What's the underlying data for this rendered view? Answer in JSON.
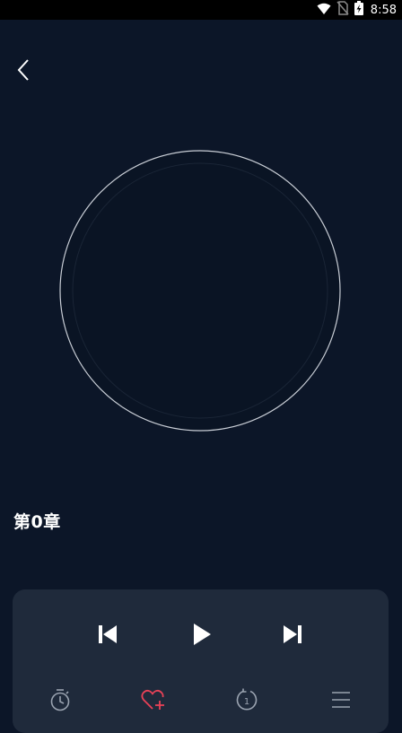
{
  "status_bar": {
    "time": "8:58",
    "icons": [
      "wifi-icon",
      "no-sim-icon",
      "battery-charging-icon"
    ]
  },
  "header": {
    "back_icon": "chevron-left-icon"
  },
  "player": {
    "chapter_title": "第0章",
    "controls": {
      "prev_icon": "skip-previous-icon",
      "play_icon": "play-icon",
      "next_icon": "skip-next-icon"
    },
    "tools": {
      "timer_icon": "timer-icon",
      "favorite_icon": "heart-plus-icon",
      "speed_icon": "playback-speed-icon",
      "speed_value": "1",
      "playlist_icon": "list-icon"
    }
  },
  "colors": {
    "background": "#0c1628",
    "panel": "#1f2a3b",
    "accent": "#e94257",
    "icon": "#ffffff",
    "muted_icon": "#9aa3b0"
  }
}
